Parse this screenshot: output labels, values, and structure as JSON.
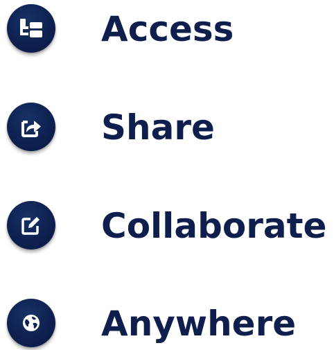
{
  "features": [
    {
      "label": "Access",
      "icon": "sitemap-icon"
    },
    {
      "label": "Share",
      "icon": "share-icon"
    },
    {
      "label": "Collaborate",
      "icon": "edit-icon"
    },
    {
      "label": "Anywhere",
      "icon": "globe-icon"
    }
  ],
  "colors": {
    "badge": "#0e2150",
    "text": "#0e1f4d",
    "icon": "#ffffff"
  }
}
